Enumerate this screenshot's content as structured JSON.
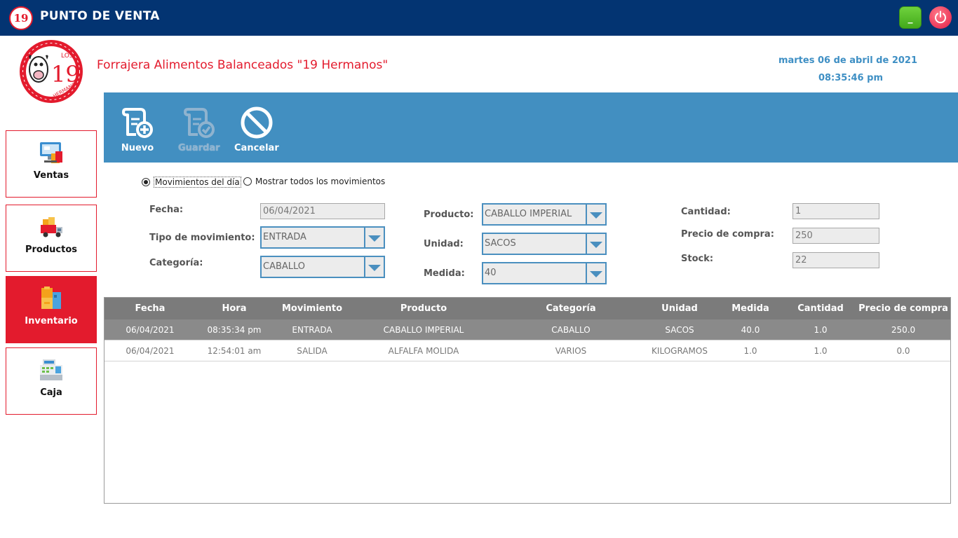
{
  "titlebar": {
    "logo_text": "19",
    "title": "PUNTO DE VENTA",
    "minimize_label": "_"
  },
  "header": {
    "company": "Forrajera Alimentos Balanceados \"19 Hermanos\"",
    "date": "martes 06 de abril de 2021",
    "time": "08:35:46 pm",
    "logo": {
      "top_text": "LOS",
      "number": "19",
      "bottom_text": "HERMANOS"
    }
  },
  "sidebar": {
    "items": [
      {
        "label": "Ventas",
        "icon": "pos-terminal-icon",
        "active": false
      },
      {
        "label": "Productos",
        "icon": "delivery-truck-icon",
        "active": false
      },
      {
        "label": "Inventario",
        "icon": "boxes-icon",
        "active": true
      },
      {
        "label": "Caja",
        "icon": "cash-register-icon",
        "active": false
      }
    ]
  },
  "toolbar": {
    "new_label": "Nuevo",
    "save_label": "Guardar",
    "cancel_label": "Cancelar"
  },
  "filters": {
    "day_label": "Movimientos del día",
    "all_label": "Mostrar todos los movimientos",
    "selected": "day"
  },
  "form": {
    "fecha_label": "Fecha:",
    "fecha_value": "06/04/2021",
    "tipo_label": "Tipo de movimiento:",
    "tipo_value": "ENTRADA",
    "categoria_label": "Categoría:",
    "categoria_value": "CABALLO",
    "producto_label": "Producto:",
    "producto_value": "CABALLO IMPERIAL",
    "unidad_label": "Unidad:",
    "unidad_value": "SACOS",
    "medida_label": "Medida:",
    "medida_value": "40",
    "cantidad_label": "Cantidad:",
    "cantidad_value": "1",
    "precio_label": "Precio de compra:",
    "precio_value": "250",
    "stock_label": "Stock:",
    "stock_value": "22"
  },
  "table": {
    "columns": [
      "Fecha",
      "Hora",
      "Movimiento",
      "Producto",
      "Categoría",
      "Unidad",
      "Medida",
      "Cantidad",
      "Precio de compra"
    ],
    "rows": [
      [
        "06/04/2021",
        "08:35:34 pm",
        "ENTRADA",
        "CABALLO IMPERIAL",
        "CABALLO",
        "SACOS",
        "40.0",
        "1.0",
        "250.0"
      ],
      [
        "06/04/2021",
        "12:54:01 am",
        "SALIDA",
        "ALFALFA MOLIDA",
        "VARIOS",
        "KILOGRAMOS",
        "1.0",
        "1.0",
        "0.0"
      ]
    ],
    "selected_row": 0
  },
  "colors": {
    "titlebar": "#033472",
    "accent_red": "#e31b2d",
    "toolbar_blue": "#428fc1",
    "table_header": "#7b7b7b"
  }
}
